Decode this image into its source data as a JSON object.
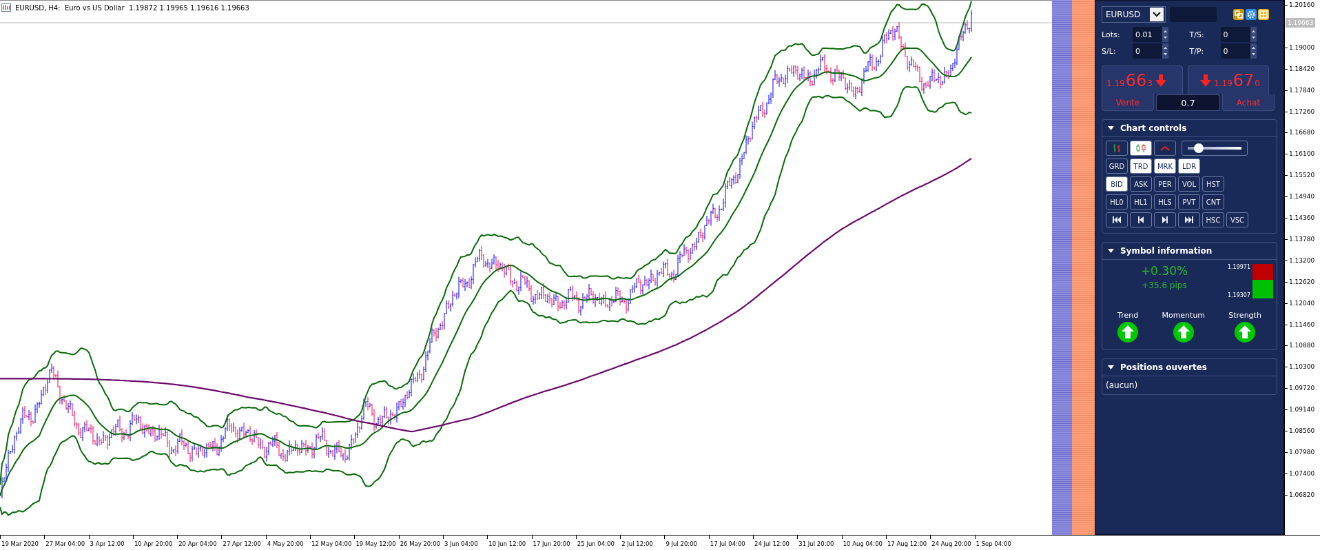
{
  "chart": {
    "title": "EURUSD, H4:  Euro vs US Dollar  1.19872 1.19965 1.19616 1.19663",
    "current_price": "1.19663",
    "price_labels": [
      "1.20160",
      "1.19000",
      "1.18420",
      "1.17840",
      "1.17260",
      "1.16680",
      "1.16100",
      "1.15520",
      "1.14940",
      "1.14360",
      "1.13780",
      "1.13200",
      "1.12620",
      "1.12040",
      "1.11460",
      "1.10880",
      "1.10300",
      "1.09720",
      "1.09140",
      "1.08560",
      "1.07980",
      "1.07400",
      "1.06820"
    ],
    "time_labels": [
      "19 Mar 2020",
      "27 Mar 04:00",
      "3 Apr 12:00",
      "10 Apr 20:00",
      "20 Apr 04:00",
      "27 Apr 12:00",
      "4 May 20:00",
      "12 May 04:00",
      "19 May 12:00",
      "26 May 20:00",
      "3 Jun 04:00",
      "10 Jun 12:00",
      "17 Jun 20:00",
      "25 Jun 04:00",
      "2 Jul 12:00",
      "9 Jul 20:00",
      "17 Jul 04:00",
      "24 Jul 12:00",
      "31 Jul 20:00",
      "10 Aug 04:00",
      "17 Aug 12:00",
      "24 Aug 20:00",
      "1 Sep 04:00"
    ]
  },
  "panel": {
    "symbol": "EURUSD",
    "inputs": [
      {
        "label": "Lots:",
        "value": "0.01"
      },
      {
        "label": "T/S:",
        "value": "0"
      },
      {
        "label": "S/L:",
        "value": "0"
      },
      {
        "label": "T/P:",
        "value": "0"
      }
    ],
    "sell": {
      "price_head": "1.19",
      "price_big": "66",
      "price_tail": "3",
      "label": "Vente"
    },
    "buy": {
      "price_head": "1.19",
      "price_big": "67",
      "price_tail": "0",
      "label": "Achat"
    },
    "spread": "0.7",
    "chart_controls": {
      "title": "Chart controls",
      "expanded": true,
      "icon_buttons": [
        {
          "selected": false
        },
        {
          "selected": true
        },
        {
          "selected": false
        }
      ],
      "slider": {
        "level": 0.2
      },
      "button_rows": [
        [
          {
            "label": "GRD",
            "selected": false
          },
          {
            "label": "TRD",
            "selected": true
          },
          {
            "label": "MRK",
            "selected": true
          },
          {
            "label": "LDR",
            "selected": true
          }
        ],
        [
          {
            "label": "BID",
            "selected": true
          },
          {
            "label": "ASK",
            "selected": false
          },
          {
            "label": "PER",
            "selected": false
          },
          {
            "label": "VOL",
            "selected": false
          },
          {
            "label": "HST",
            "selected": false
          }
        ],
        [
          {
            "label": "HL0",
            "selected": false
          },
          {
            "label": "HL1",
            "selected": false
          },
          {
            "label": "HLS",
            "selected": false
          },
          {
            "label": "PVT",
            "selected": false
          },
          {
            "label": "CNT",
            "selected": false
          }
        ]
      ],
      "nav_buttons": [
        {
          "selected": false
        },
        {
          "selected": false
        },
        {
          "selected": false
        },
        {
          "selected": false
        }
      ],
      "scale_buttons": [
        {
          "label": "HSC",
          "selected": false
        },
        {
          "label": "VSC",
          "selected": false
        }
      ]
    },
    "symbol_information": {
      "title": "Symbol information",
      "expanded": true,
      "change": "+0.30%",
      "pips": "+35.6 pips",
      "high": "1.19971",
      "low": "1.19307",
      "indicators": [
        {
          "label": "Trend",
          "rising": true
        },
        {
          "label": "Momentum",
          "rising": true
        },
        {
          "label": "Strength",
          "rising": true
        }
      ]
    },
    "open_positions": {
      "title": "Positions ouvertes",
      "expanded": true,
      "text": "(aucun)"
    }
  }
}
